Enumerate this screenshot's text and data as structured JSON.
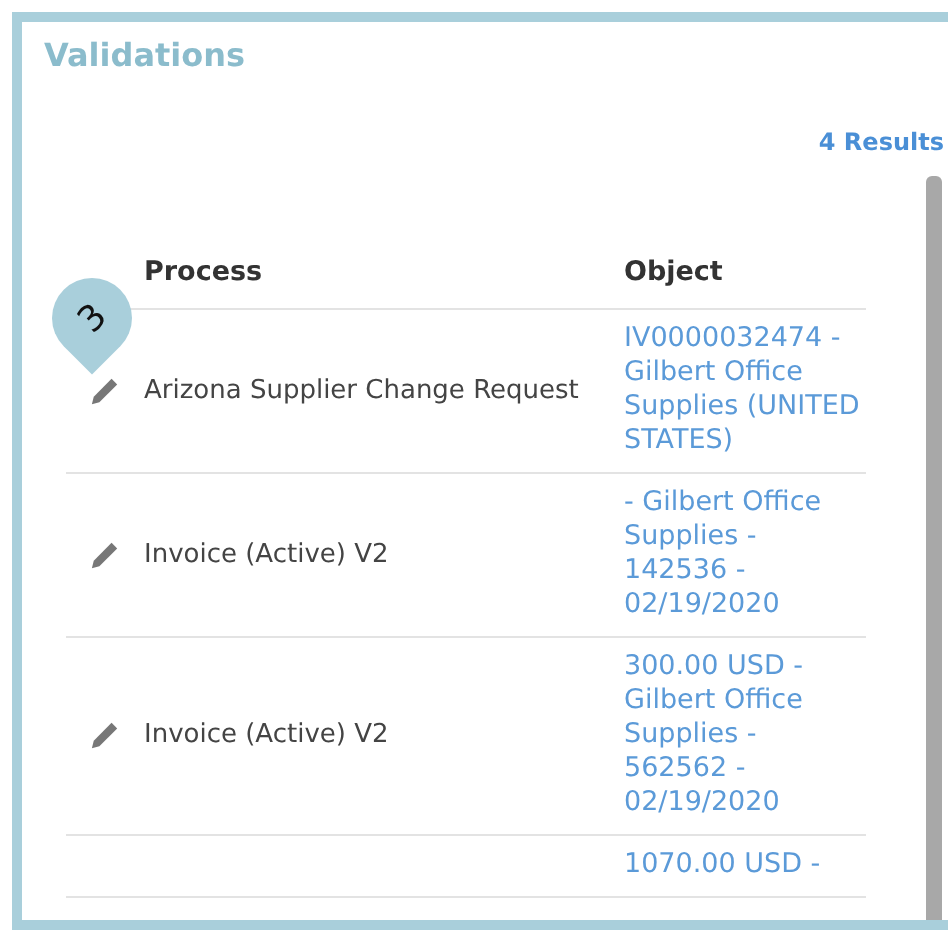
{
  "panel": {
    "title": "Validations",
    "results_count": "4 Results"
  },
  "marker": {
    "label": "3"
  },
  "table": {
    "columns": [
      "Process",
      "Object"
    ],
    "rows": [
      {
        "process": "Arizona Supplier Change Request",
        "object": "IV0000032474 - Gilbert Office Supplies (UNITED STATES)",
        "editable": true
      },
      {
        "process": "Invoice (Active) V2",
        "object": "- Gilbert Office Supplies - 142536 - 02/19/2020",
        "editable": true
      },
      {
        "process": "Invoice (Active) V2",
        "object": "300.00 USD - Gilbert Office Supplies - 562562 - 02/19/2020",
        "editable": true
      },
      {
        "object": "1070.00 USD -"
      }
    ]
  }
}
